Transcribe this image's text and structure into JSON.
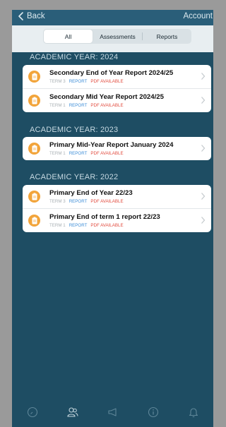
{
  "nav": {
    "back_label": "Back",
    "account_label": "Account"
  },
  "segments": [
    "All",
    "Assessments",
    "Reports"
  ],
  "years": [
    {
      "heading": "ACADEMIC YEAR: 2024",
      "items": [
        {
          "title": "Secondary End of Year Report 2024/25",
          "term": "TERM 3",
          "type": "REPORT",
          "pdf": "PDF AVAILABLE"
        },
        {
          "title": "Secondary Mid Year Report 2024/25",
          "term": "TERM 1",
          "type": "REPORT",
          "pdf": "PDF AVAILABLE"
        }
      ]
    },
    {
      "heading": "ACADEMIC YEAR: 2023",
      "items": [
        {
          "title": "Primary Mid-Year Report January 2024",
          "term": "TERM 1",
          "type": "REPORT",
          "pdf": "PDF AVAILABLE"
        }
      ]
    },
    {
      "heading": "ACADEMIC YEAR: 2022",
      "items": [
        {
          "title": "Primary End of Year 22/23",
          "term": "TERM 3",
          "type": "REPORT",
          "pdf": "PDF AVAILABLE"
        },
        {
          "title": "Primary End of term 1 report 22/23",
          "term": "TERM 1",
          "type": "REPORT",
          "pdf": "PDF AVAILABLE"
        }
      ]
    }
  ],
  "tabbar": [
    "dashboard-icon",
    "students-icon",
    "announcements-icon",
    "info-icon",
    "notifications-icon"
  ],
  "colors": {
    "background": "#1e4d63",
    "accent": "#f2a43a",
    "report": "#3f8fd8",
    "pdf": "#e24b3e"
  }
}
